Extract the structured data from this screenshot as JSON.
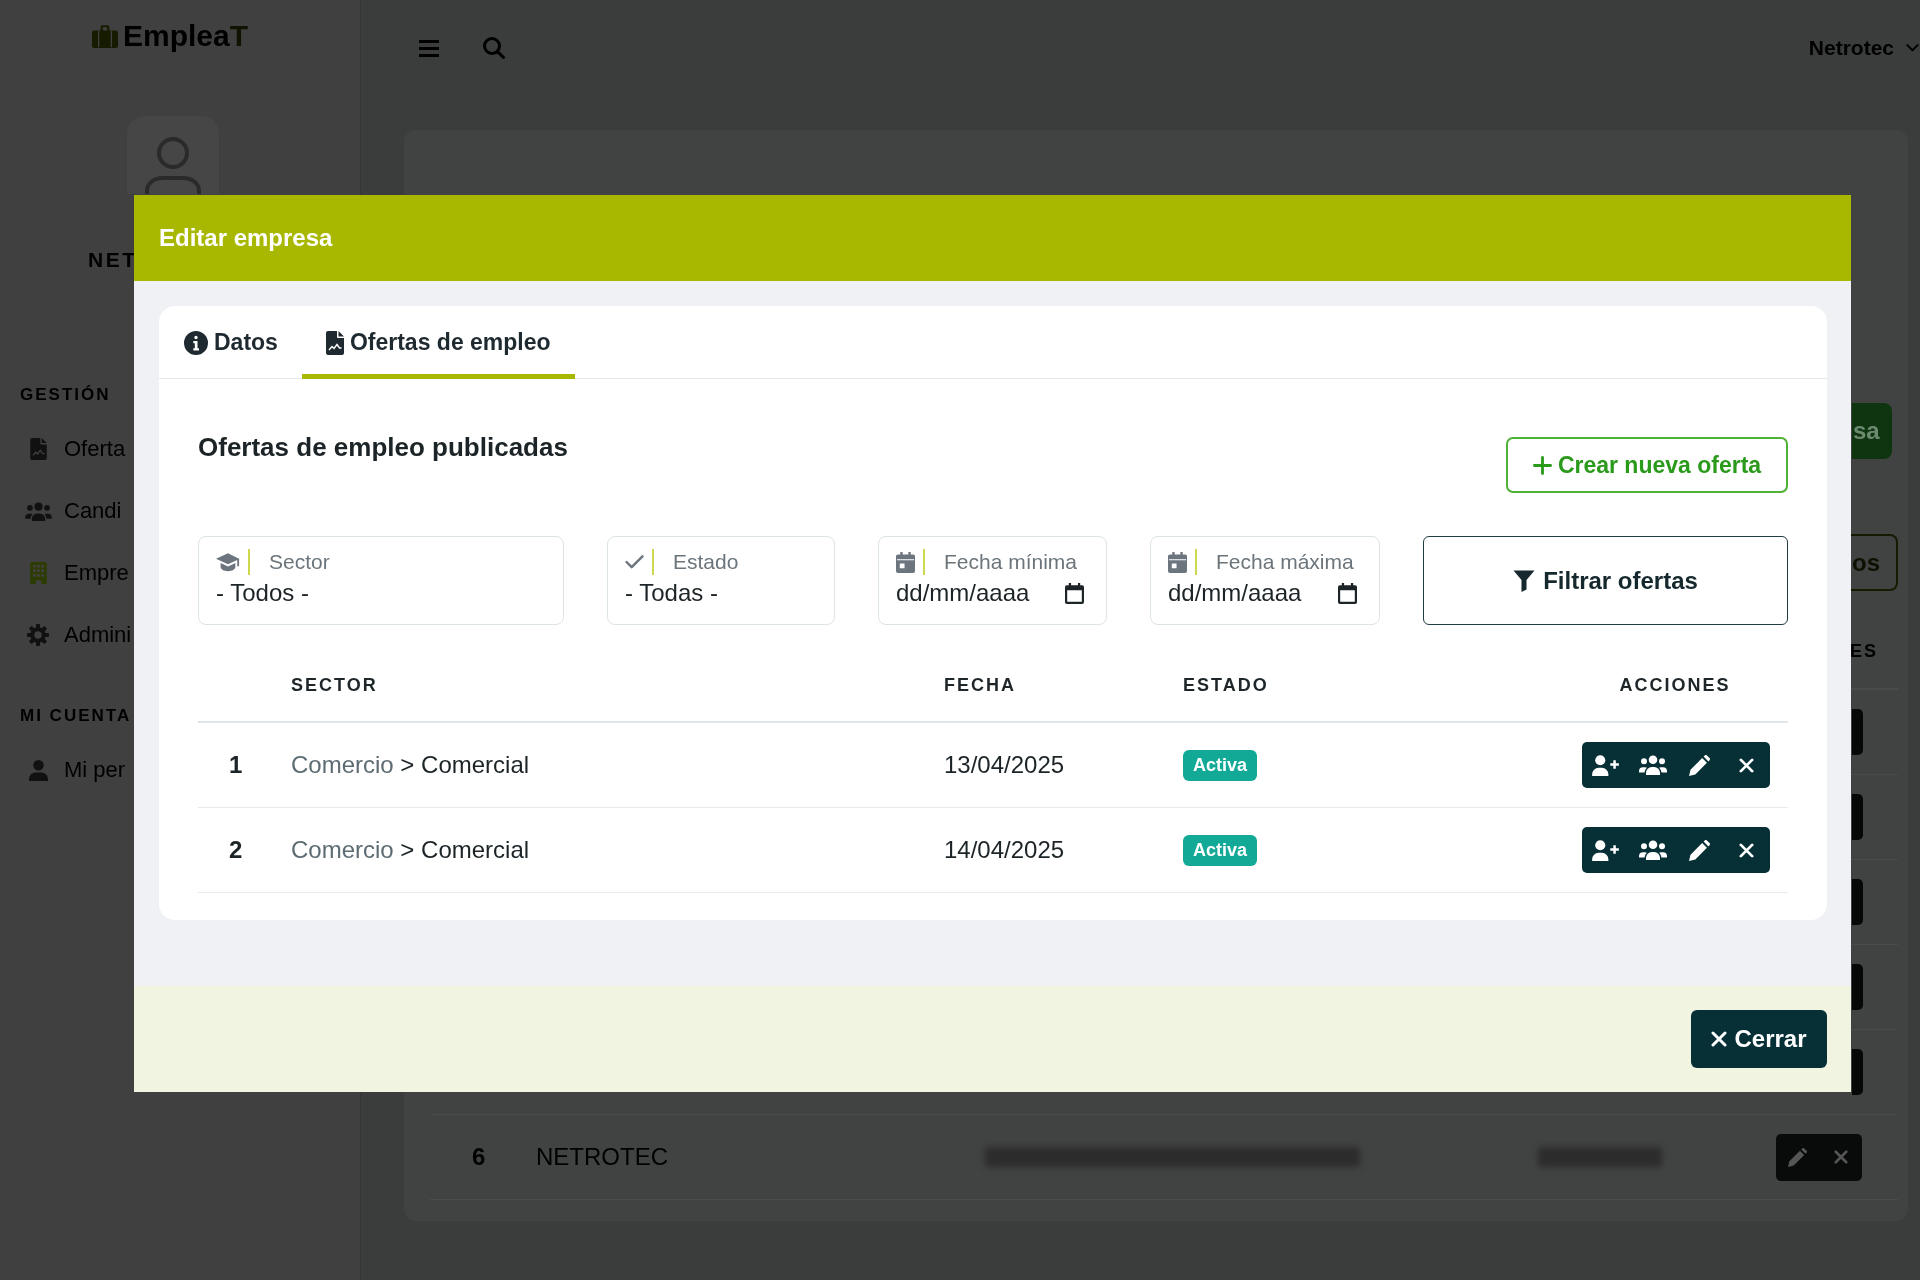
{
  "sidebar": {
    "logo": {
      "text": "Emplea",
      "accent": "T"
    },
    "profile": {
      "name": "NET"
    },
    "sections": [
      {
        "title": "GESTIÓN",
        "items": [
          {
            "label": "Oferta",
            "selected": false
          },
          {
            "label": "Candi",
            "selected": false
          },
          {
            "label": "Empre",
            "selected": true
          },
          {
            "label": "Admini",
            "selected": false
          }
        ]
      },
      {
        "title": "MI CUENTA",
        "items": [
          {
            "label": "Mi per",
            "selected": false
          }
        ]
      }
    ]
  },
  "top_bar": {
    "user_menu": "Netrotec"
  },
  "page_behind": {
    "primary_button": "sa",
    "outline_button": "os",
    "column_header": "ES",
    "last_row": {
      "number": "6",
      "name": "NETROTEC"
    }
  },
  "modal": {
    "title": "Editar empresa",
    "tabs": [
      {
        "label": "Datos",
        "selected": false
      },
      {
        "label": "Ofertas de empleo",
        "selected": true
      }
    ],
    "heading": "Ofertas de empleo publicadas",
    "create_button": "Crear nueva oferta",
    "filters": [
      {
        "kind": "select",
        "label": "Sector",
        "value": "- Todos -"
      },
      {
        "kind": "select",
        "label": "Estado",
        "value": "- Todas -"
      },
      {
        "kind": "date",
        "label": "Fecha mínima",
        "placeholder": "dd/mm/aaaa"
      },
      {
        "kind": "date",
        "label": "Fecha máxima",
        "placeholder": "dd/mm/aaaa"
      }
    ],
    "filter_button": "Filtrar ofertas",
    "table": {
      "columns": [
        "SECTOR",
        "FECHA",
        "ESTADO",
        "ACCIONES"
      ],
      "rows": [
        {
          "number": "1",
          "sector": {
            "category": "Comercio",
            "separator": ">",
            "subcategory": "Comercial"
          },
          "date": "13/04/2025",
          "status": "Activa"
        },
        {
          "number": "2",
          "sector": {
            "category": "Comercio",
            "separator": ">",
            "subcategory": "Comercial"
          },
          "date": "14/04/2025",
          "status": "Activa"
        }
      ]
    },
    "close_button": "Cerrar"
  }
}
